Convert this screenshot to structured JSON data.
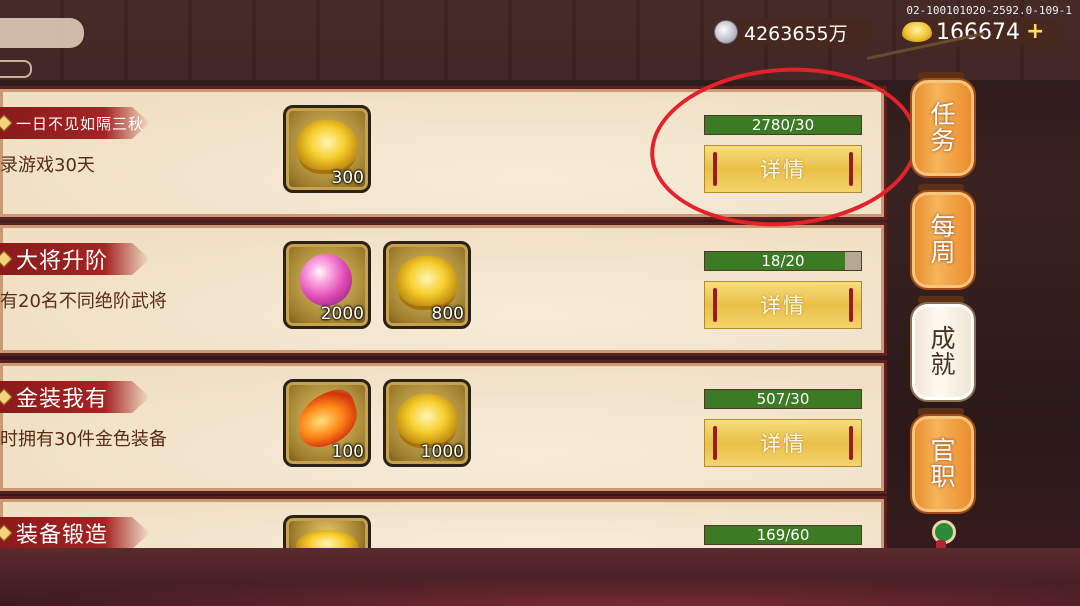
{
  "header": {
    "version": "02-100101020-2592.0-109-1",
    "silver_amount": "4263655万",
    "gold_amount": "166674",
    "silver_icon": "silver-coin-icon",
    "gold_icon": "gold-ingot-icon"
  },
  "tasks": [
    {
      "title": "一日不见如隔三秋",
      "description": "录游戏30天",
      "rewards": [
        {
          "icon": "gold-ingot",
          "count": "300"
        }
      ],
      "progress_text": "2780/30",
      "progress": 1.0,
      "button_label": "详情"
    },
    {
      "title": "大将升阶",
      "description": "有20名不同绝阶武将",
      "rewards": [
        {
          "icon": "pink-pearl",
          "count": "2000"
        },
        {
          "icon": "gold-ingot",
          "count": "800"
        }
      ],
      "progress_text": "18/20",
      "progress": 0.9,
      "button_label": "详情"
    },
    {
      "title": "金装我有",
      "description": "时拥有30件金色装备",
      "rewards": [
        {
          "icon": "phoenix-feather",
          "count": "100"
        },
        {
          "icon": "gold-ingot",
          "count": "1000"
        }
      ],
      "progress_text": "507/30",
      "progress": 1.0,
      "button_label": "详情"
    },
    {
      "title": "装备锻造",
      "description": "",
      "rewards": [
        {
          "icon": "gold-ingot",
          "count": ""
        }
      ],
      "progress_text": "169/60",
      "progress": 1.0,
      "button_label": ""
    }
  ],
  "side_tabs": [
    {
      "label_top": "任",
      "label_bottom": "务",
      "active": false
    },
    {
      "label_top": "每",
      "label_bottom": "周",
      "active": false
    },
    {
      "label_top": "成",
      "label_bottom": "就",
      "active": true
    },
    {
      "label_top": "官",
      "label_bottom": "职",
      "active": false
    }
  ],
  "colors": {
    "progress_fill": "#3c7a24",
    "highlight": "#e3222a",
    "banner": "#a52424"
  }
}
